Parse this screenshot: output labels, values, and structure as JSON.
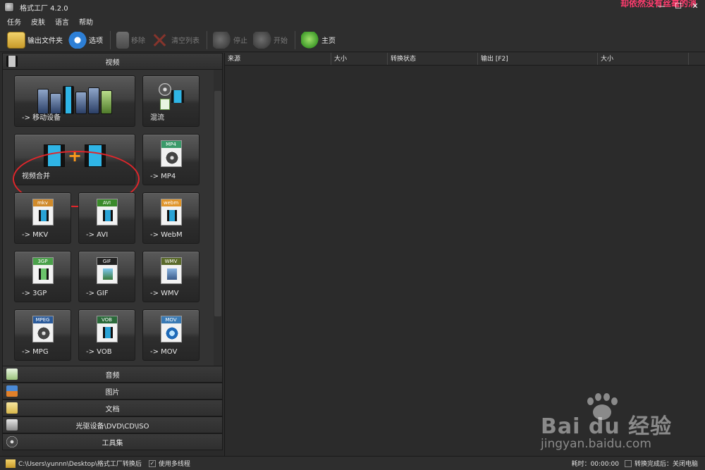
{
  "window": {
    "title": "格式工厂 4.2.0",
    "overlay_text": "却依然没有丝毫的消",
    "buttons": {
      "minimize": "—",
      "maximize": "☐",
      "close": "✕"
    }
  },
  "menu": [
    "任务",
    "皮肤",
    "语言",
    "帮助"
  ],
  "toolbar": {
    "output_folder": "输出文件夹",
    "options": "选项",
    "remove": "移除",
    "clear_list": "清空列表",
    "stop": "停止",
    "start": "开始",
    "home": "主页"
  },
  "sections": {
    "video": "视频",
    "audio": "音频",
    "image": "图片",
    "document": "文档",
    "optical": "光驱设备\\DVD\\CD\\ISO",
    "tools": "工具集"
  },
  "video_tiles": {
    "mobile": "-> 移动设备",
    "mux": "混流",
    "merge": "视频合并",
    "mp4": "-> MP4",
    "mkv": "-> MKV",
    "avi": "-> AVI",
    "webm": "-> WebM",
    "3gp": "-> 3GP",
    "gif": "-> GIF",
    "wmv": "-> WMV",
    "mpg": "-> MPG",
    "vob": "-> VOB",
    "mov": "-> MOV"
  },
  "tile_badges": {
    "mp4": "MP4",
    "mkv": "mkv",
    "avi": "AVI",
    "webm": "webm",
    "3gp": "3GP",
    "gif": "GIF",
    "wmv": "WMV",
    "mpg": "MPEG",
    "vob": "VOB",
    "mov": "MOV"
  },
  "columns": [
    "来源",
    "大小",
    "转换状态",
    "输出 [F2]",
    "大小"
  ],
  "status": {
    "path": "C:\\Users\\yunnn\\Desktop\\格式工厂转换后",
    "multithread_label": "使用多线程",
    "multithread_checked": "✓",
    "elapsed": "耗时：00:00:00",
    "after_done": "转换完成后：关闭电脑"
  },
  "watermark": {
    "brand": "Bai du 经验",
    "url": "jingyan.baidu.com"
  },
  "colors": {
    "background": "#2b2b2b",
    "annotation": "#e0262b",
    "overlay_text": "#ff3c6e"
  }
}
